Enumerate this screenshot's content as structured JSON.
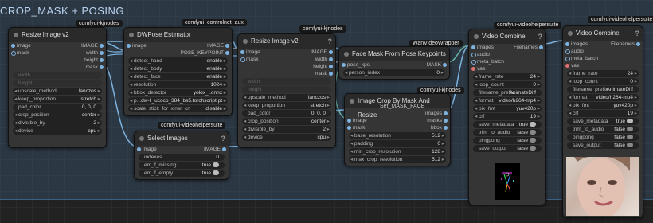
{
  "group": {
    "title": "CROP_MASK + POSING"
  },
  "badges": {
    "b1": "comfyui-kjnodes",
    "b2": "comfyui_controlnet_aux",
    "b3": "comfyui-kjnodes",
    "b4": "comfyui-videohelpersuite",
    "b5": "comfyui-videohelpersuite",
    "b6": "WanVideoWrapper",
    "b7": "comfyui-kjnodes",
    "b8": "comfyui-videohelpersuite"
  },
  "resize1": {
    "title": "Resize Image v2",
    "inputs": [
      "image",
      "mask"
    ],
    "outputs": [
      "IMAGE",
      "width",
      "height",
      "mask"
    ],
    "widgets": [
      {
        "label": "width",
        "value": "",
        "disabled": true
      },
      {
        "label": "height",
        "value": "",
        "disabled": true
      },
      {
        "label": "upscale_method",
        "value": "lanczos"
      },
      {
        "label": "keep_proportion",
        "value": "stretch"
      },
      {
        "label": "pad_color",
        "value": "0, 0, 0"
      },
      {
        "label": "crop_position",
        "value": "center"
      },
      {
        "label": "divisible_by",
        "value": "2"
      },
      {
        "label": "device",
        "value": "cpu"
      }
    ]
  },
  "dwpose": {
    "title": "DWPose Estimator",
    "inputs": [
      "image"
    ],
    "outputs": [
      "IMAGE",
      "POSE_KEYPOINT"
    ],
    "widgets": [
      {
        "label": "detect_hand",
        "value": "enable"
      },
      {
        "label": "detect_body",
        "value": "enable"
      },
      {
        "label": "detect_face",
        "value": "enable"
      },
      {
        "label": "resolution",
        "value": "1024"
      },
      {
        "label": "bbox_detector",
        "value": "yolox_l.onnx"
      },
      {
        "label": "p...",
        "value": "dw-ll_ucoco_384_bs5.torchscript.pt"
      },
      {
        "label": "scale_stick_for_xinsr_cn",
        "value": "disable"
      }
    ]
  },
  "select": {
    "title": "Select Images",
    "inputs": [
      "image"
    ],
    "outputs": [
      "IMAGE"
    ],
    "widgets": [
      {
        "label": "indexes",
        "value": "0"
      },
      {
        "label": "err_if_missing",
        "value": "true"
      },
      {
        "label": "err_if_empty",
        "value": "true"
      }
    ]
  },
  "resize2": {
    "title": "Resize Image v2",
    "inputs": [
      "image",
      "mask"
    ],
    "outputs": [
      "IMAGE",
      "width",
      "height",
      "mask"
    ],
    "widgets": [
      {
        "label": "width",
        "value": "",
        "disabled": true
      },
      {
        "label": "height",
        "value": "",
        "disabled": true
      },
      {
        "label": "upscale_method",
        "value": "lanczos"
      },
      {
        "label": "keep_proportion",
        "value": "stretch"
      },
      {
        "label": "pad_color",
        "value": "0, 0, 0"
      },
      {
        "label": "crop_position",
        "value": "center"
      },
      {
        "label": "divisible_by",
        "value": "2"
      },
      {
        "label": "device",
        "value": "cpu"
      }
    ]
  },
  "facemask": {
    "title": "Face Mask From Pose Keypoints",
    "inputs": [
      "pose_kps"
    ],
    "outputs": [
      "MASK"
    ],
    "widgets": [
      {
        "label": "person_index",
        "value": "0"
      }
    ]
  },
  "crop": {
    "title": "Image Crop By Mask And Resize",
    "subtitle": "Set_MASK_FACE",
    "inputs": [
      "image",
      "mask"
    ],
    "outputs": [
      "images",
      "masks",
      "bbox"
    ],
    "widgets": [
      {
        "label": "base_resolution",
        "value": "512"
      },
      {
        "label": "padding",
        "value": "0"
      },
      {
        "label": "min_crop_resolution",
        "value": "128"
      },
      {
        "label": "max_crop_resolution",
        "value": "512"
      }
    ]
  },
  "vc1": {
    "title": "Video Combine",
    "inputs": [
      "images",
      "audio",
      "meta_batch",
      "vae"
    ],
    "outputs": [
      "Filenames"
    ],
    "widgets": [
      {
        "label": "frame_rate",
        "value": "24"
      },
      {
        "label": "loop_count",
        "value": "0"
      },
      {
        "label": "filename_prefix",
        "value": "AnimateDiff"
      },
      {
        "label": "format",
        "value": "video/h264-mp4"
      },
      {
        "label": "pix_fmt",
        "value": "yuv420p"
      },
      {
        "label": "crf",
        "value": "19"
      },
      {
        "label": "save_metadata",
        "value": "true"
      },
      {
        "label": "trim_to_audio",
        "value": "false"
      },
      {
        "label": "pingpong",
        "value": "false"
      },
      {
        "label": "save_output",
        "value": "false"
      }
    ]
  },
  "vc2": {
    "title": "Video Combine",
    "inputs": [
      "images",
      "audio",
      "meta_batch",
      "vae"
    ],
    "outputs": [
      "Filenames"
    ],
    "widgets": [
      {
        "label": "frame_rate",
        "value": "24"
      },
      {
        "label": "loop_count",
        "value": "0"
      },
      {
        "label": "filename_prefix",
        "value": "AnimateDiff"
      },
      {
        "label": "format",
        "value": "video/h264-mp4"
      },
      {
        "label": "pix_fmt",
        "value": "yuv420p"
      },
      {
        "label": "crf",
        "value": "19"
      },
      {
        "label": "save_metadata",
        "value": "true"
      },
      {
        "label": "trim_to_audio",
        "value": "false"
      },
      {
        "label": "pingpong",
        "value": "false"
      },
      {
        "label": "save_output",
        "value": "false"
      }
    ]
  },
  "colors": {
    "link_image": "#7db3e0",
    "link_mask": "#6ab0a0",
    "link_pose": "#b0b0b0"
  }
}
